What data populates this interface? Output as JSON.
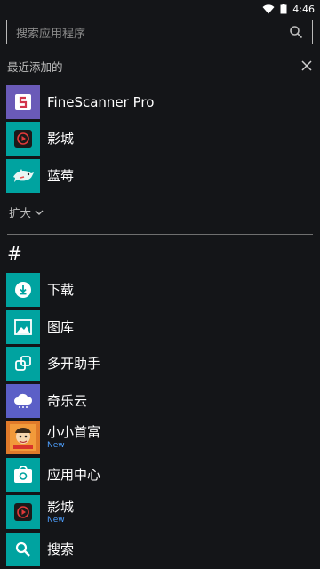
{
  "status_bar": {
    "time": "4:46"
  },
  "search": {
    "placeholder": "搜索应用程序"
  },
  "recent": {
    "title": "最近添加的"
  },
  "recent_apps": [
    {
      "label": "FineScanner Pro",
      "color": "#6a5ab8"
    },
    {
      "label": "影城",
      "color": "#00a3a0"
    },
    {
      "label": "蓝莓",
      "color": "#00a3a0"
    }
  ],
  "expand": {
    "label": "扩大"
  },
  "group": {
    "letter": "#"
  },
  "apps": [
    {
      "label": "下载",
      "color": "#00a3a0",
      "icon": "download-icon"
    },
    {
      "label": "图库",
      "color": "#00a3a0",
      "icon": "image-icon"
    },
    {
      "label": "多开助手",
      "color": "#00a3a0",
      "icon": "clone-icon"
    },
    {
      "label": "奇乐云",
      "color": "#00a3a0",
      "icon": "cloud-icon"
    },
    {
      "label": "小小首富",
      "badge": "New",
      "color": "#00a3a0",
      "icon": "game-icon"
    },
    {
      "label": "应用中心",
      "color": "#00a3a0",
      "icon": "store-icon"
    },
    {
      "label": "影城",
      "badge": "New",
      "color": "#00a3a0",
      "icon": "play-icon"
    },
    {
      "label": "搜索",
      "color": "#00a3a0",
      "icon": "search-icon"
    }
  ]
}
